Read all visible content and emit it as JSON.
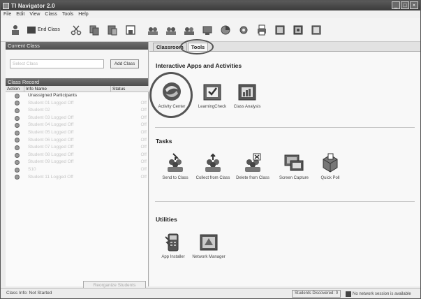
{
  "window": {
    "title": "TI Navigator 2.0",
    "controls": [
      "_",
      "□",
      "×"
    ]
  },
  "menu": [
    "File",
    "Edit",
    "View",
    "Class",
    "Tools",
    "Help"
  ],
  "toolbar": {
    "end_class_label": "End Class",
    "icons": [
      "class-icon",
      "cut-icon",
      "copy-icon",
      "paste-icon",
      "save-icon",
      "send-to-class-icon",
      "collect-icon",
      "delete-icon",
      "screen-capture-icon",
      "quick-poll-icon",
      "settings-icon",
      "print-icon",
      "grade-icon",
      "chart-icon",
      "report-icon"
    ]
  },
  "left": {
    "current_class_header": "Current Class",
    "class_select_value": "Select Class",
    "add_class_button": "Add Class",
    "class_record_header": "Class Record",
    "columns": [
      "Action",
      "Info Name",
      "Status"
    ],
    "rows": [
      {
        "name": "Unassigned Participants",
        "status": ""
      },
      {
        "name": "Student 01 Logged Off",
        "status": "Off"
      },
      {
        "name": "Student 02",
        "status": "Off"
      },
      {
        "name": "Student 03 Logged Off",
        "status": "Off"
      },
      {
        "name": "Student 04 Logged Off",
        "status": "Off"
      },
      {
        "name": "Student 05 Logged Off",
        "status": "Off"
      },
      {
        "name": "Student 06 Logged Off",
        "status": "Off"
      },
      {
        "name": "Student 07 Logged Off",
        "status": "Off"
      },
      {
        "name": "Student 08 Logged Off",
        "status": "Off"
      },
      {
        "name": "Student 09 Logged Off",
        "status": "Off"
      },
      {
        "name": "S10",
        "status": "Off"
      },
      {
        "name": "Student 11 Logged Off",
        "status": "Off"
      }
    ],
    "bottom_button": "Reorganize Students"
  },
  "right": {
    "tabs": [
      {
        "label": "Classroom",
        "active": false
      },
      {
        "label": "Tools",
        "active": true
      }
    ],
    "groups": {
      "interactive": {
        "title": "Interactive Apps and Activities",
        "items": [
          {
            "label": "Activity Center",
            "icon": "activity-center-icon"
          },
          {
            "label": "LearningCheck",
            "icon": "learningcheck-icon"
          },
          {
            "label": "Class Analysis",
            "icon": "class-analysis-icon"
          }
        ]
      },
      "tasks": {
        "title": "Tasks",
        "items": [
          {
            "label": "Send to Class",
            "icon": "send-to-class-icon"
          },
          {
            "label": "Collect from Class",
            "icon": "collect-from-class-icon"
          },
          {
            "label": "Delete from Class",
            "icon": "delete-from-class-icon"
          },
          {
            "label": "Screen Capture",
            "icon": "screen-capture-icon"
          },
          {
            "label": "Quick Poll",
            "icon": "quick-poll-icon"
          }
        ]
      },
      "utilities": {
        "title": "Utilities",
        "items": [
          {
            "label": "App Installer",
            "icon": "app-installer-icon"
          },
          {
            "label": "Network Manager",
            "icon": "network-manager-icon"
          }
        ]
      }
    }
  },
  "status": {
    "left": "Class Info: Not Started",
    "discovery": "Students Discovered: 0",
    "session": "No network session is available"
  },
  "colors": {
    "titlebar": "#4a4a4a",
    "header": "#5d5d5d",
    "highlight_ring": "#555555"
  }
}
